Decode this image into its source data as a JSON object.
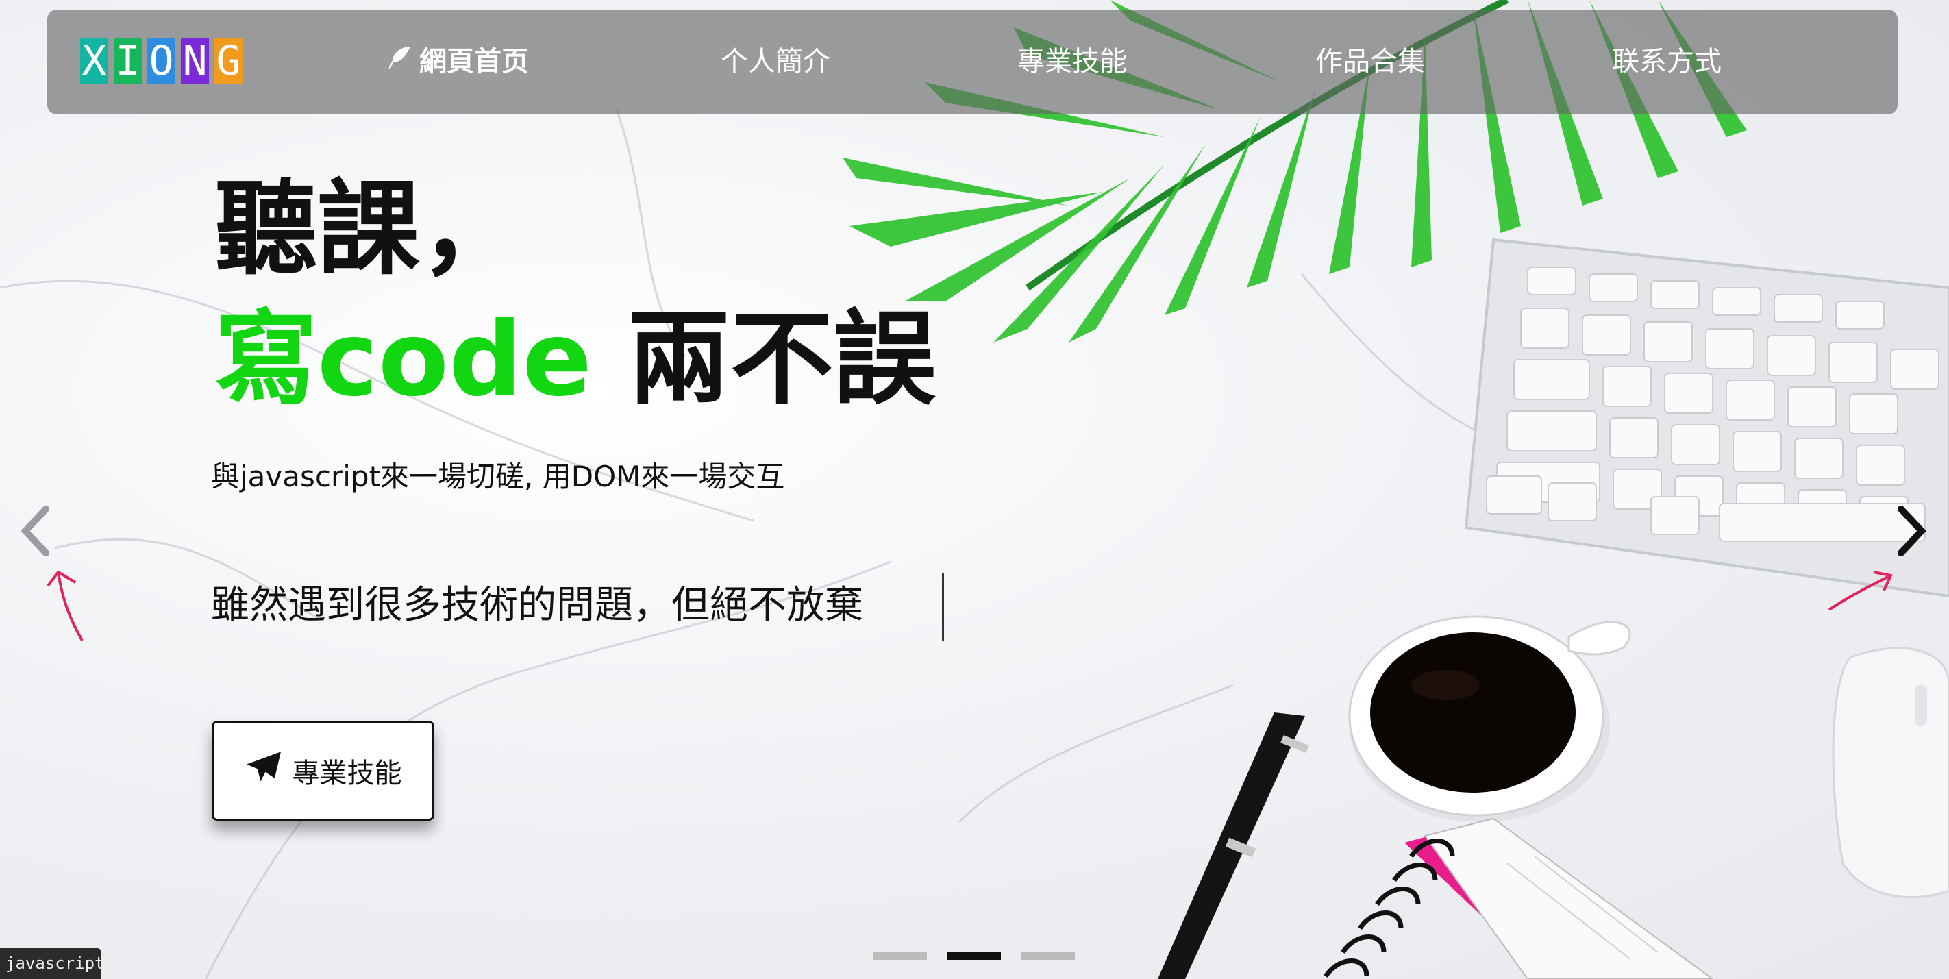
{
  "logo": {
    "letters": [
      {
        "char": "X",
        "color": "#12b5a2"
      },
      {
        "char": "I",
        "color": "#14b85a"
      },
      {
        "char": "O",
        "color": "#2e8de0"
      },
      {
        "char": "N",
        "color": "#7a2ad8"
      },
      {
        "char": "G",
        "color": "#f29a1e"
      }
    ]
  },
  "nav": {
    "items": [
      {
        "label": "網頁首页",
        "active": true,
        "icon": "feather-icon"
      },
      {
        "label": "个人簡介",
        "active": false
      },
      {
        "label": "專業技能",
        "active": false
      },
      {
        "label": "作品合集",
        "active": false
      },
      {
        "label": "联系方式",
        "active": false
      }
    ]
  },
  "hero": {
    "line1": "聽課，",
    "line2_green": "寫code",
    "line2_dark": " 兩不誤",
    "subtitle": "與javascript來一場切磋, 用DOM來一場交互",
    "typed": "雖然遇到很多技術的問題，但絕不放棄"
  },
  "cta": {
    "label": "專業技能",
    "icon": "paper-plane-icon"
  },
  "carousel": {
    "slide_count": 3,
    "active_index": 1
  },
  "status": {
    "text": "javascript:;"
  },
  "colors": {
    "accent_green": "#12d612",
    "nav_bg": "rgba(100,100,100,0.62)"
  }
}
